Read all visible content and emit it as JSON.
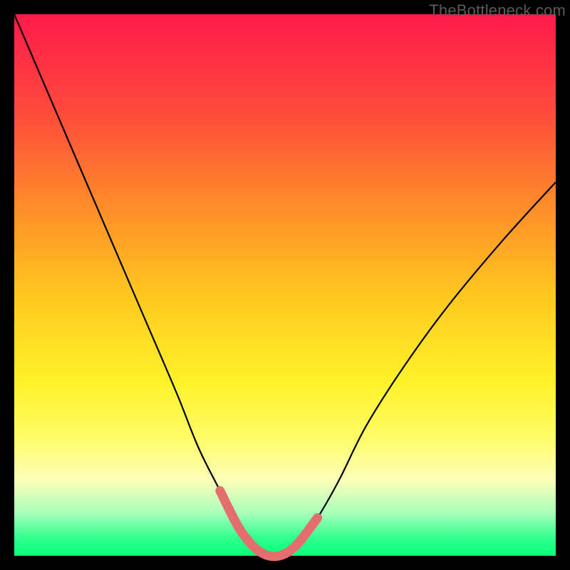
{
  "watermark": "TheBottleneck.com",
  "colors": {
    "frame_bg": "#000000",
    "curve_stroke": "#000000",
    "highlight_stroke": "#e46d6d"
  },
  "chart_data": {
    "type": "line",
    "title": "",
    "xlabel": "",
    "ylabel": "",
    "xlim": [
      0,
      100
    ],
    "ylim": [
      0,
      100
    ],
    "series": [
      {
        "name": "bottleneck-curve",
        "x": [
          0,
          6,
          12,
          18,
          24,
          30,
          34,
          38,
          41,
          43,
          45,
          47,
          49,
          51,
          53,
          56,
          60,
          65,
          72,
          80,
          90,
          100
        ],
        "values": [
          100,
          86,
          72,
          58,
          44,
          30,
          20,
          12,
          6,
          3,
          1,
          0,
          0,
          1,
          3,
          7,
          14,
          24,
          35,
          46,
          58,
          69
        ]
      }
    ],
    "highlight": {
      "name": "optimal-range",
      "x": [
        38,
        41,
        43,
        45,
        47,
        49,
        51,
        53,
        56
      ],
      "values": [
        12,
        6,
        3,
        1,
        0,
        0,
        1,
        3,
        7
      ]
    },
    "annotations": []
  }
}
